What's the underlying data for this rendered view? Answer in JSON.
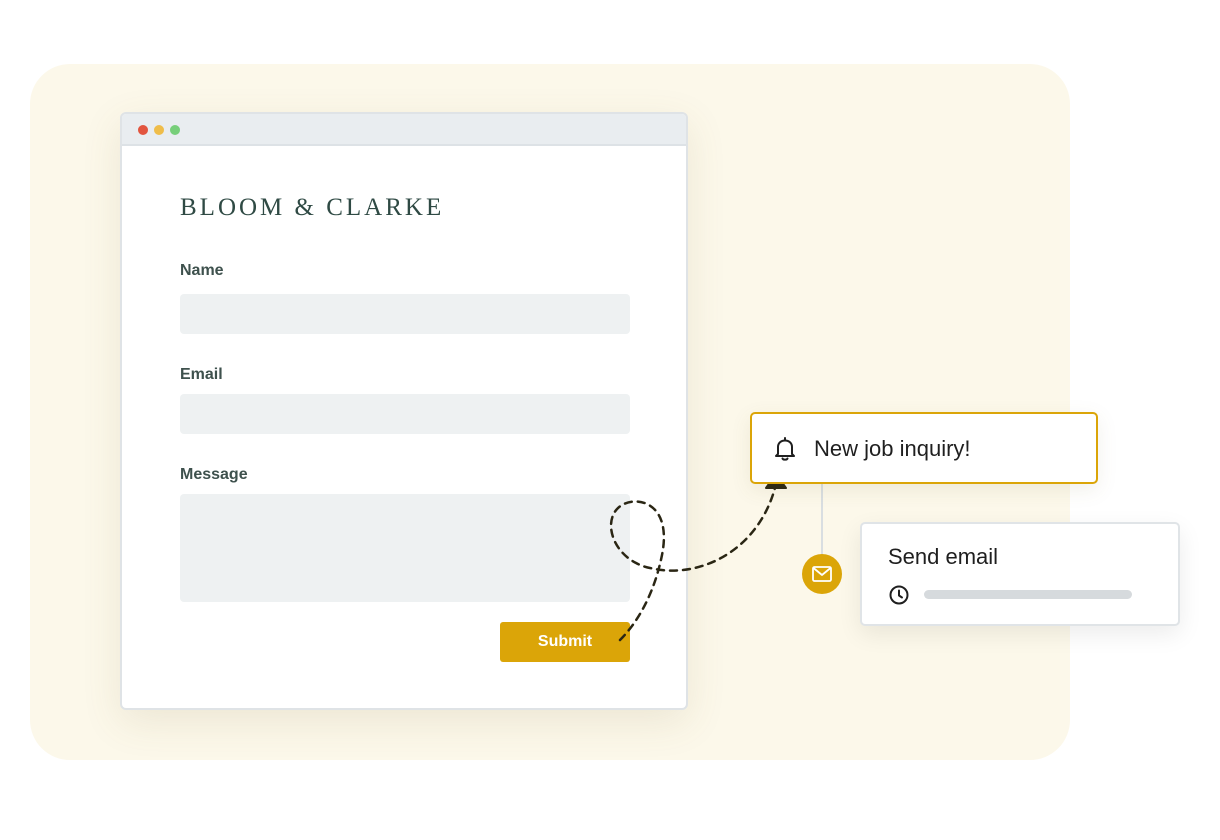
{
  "window": {
    "controls": [
      "close",
      "minimize",
      "maximize"
    ],
    "control_colors": {
      "close": "#e2553f",
      "minimize": "#efbd4a",
      "maximize": "#77cf7a"
    }
  },
  "form": {
    "brand": "BLOOM & CLARKE",
    "name_label": "Name",
    "name_value": "",
    "email_label": "Email",
    "email_value": "",
    "message_label": "Message",
    "message_value": "",
    "submit_label": "Submit"
  },
  "workflow": {
    "trigger": {
      "title": "New job inquiry!",
      "icon": "bell-icon"
    },
    "action": {
      "title": "Send email",
      "icon": "clock-icon",
      "badge_icon": "mail-icon"
    }
  },
  "colors": {
    "accent": "#dba508",
    "brand_text": "#2f4a44",
    "backdrop": "#fcf8ea"
  }
}
